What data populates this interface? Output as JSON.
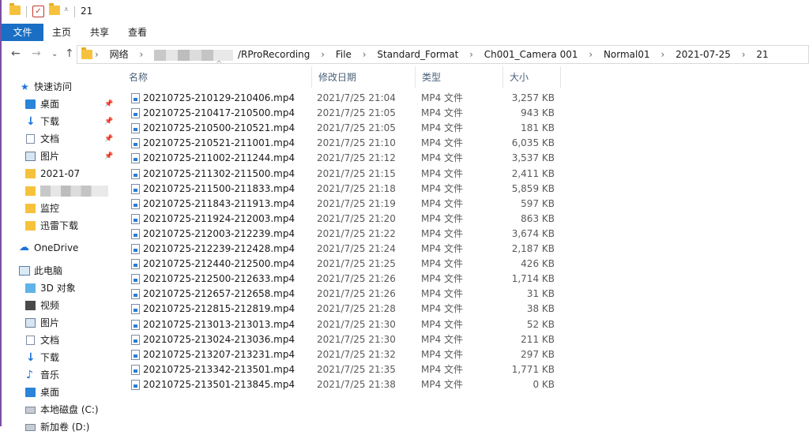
{
  "window": {
    "title": "21"
  },
  "ribbon": {
    "tabs": [
      "文件",
      "主页",
      "共享",
      "查看"
    ]
  },
  "address": {
    "crumbs": [
      "网络",
      "/RProRecording",
      "File",
      "Standard_Format",
      "Ch001_Camera 001",
      "Normal01",
      "2021-07-25",
      "21"
    ]
  },
  "nav": {
    "quick_access": "快速访问",
    "quick_items": [
      {
        "label": "桌面",
        "icon": "desktop-icon",
        "pinned": true
      },
      {
        "label": "下载",
        "icon": "download-icon",
        "pinned": true
      },
      {
        "label": "文档",
        "icon": "document-icon",
        "pinned": true
      },
      {
        "label": "图片",
        "icon": "picture-icon",
        "pinned": true
      },
      {
        "label": "2021-07",
        "icon": "folder-icon",
        "pinned": false
      },
      {
        "label": "",
        "icon": "folder-icon",
        "pinned": false
      },
      {
        "label": "监控",
        "icon": "folder-icon",
        "pinned": false
      },
      {
        "label": "迅雷下载",
        "icon": "folder-icon",
        "pinned": false
      }
    ],
    "onedrive": "OneDrive",
    "this_pc": "此电脑",
    "pc_items": [
      {
        "label": "3D 对象",
        "icon": "3d-objects-icon"
      },
      {
        "label": "视频",
        "icon": "video-icon"
      },
      {
        "label": "图片",
        "icon": "picture-icon"
      },
      {
        "label": "文档",
        "icon": "document-icon"
      },
      {
        "label": "下载",
        "icon": "download-icon"
      },
      {
        "label": "音乐",
        "icon": "music-icon"
      },
      {
        "label": "桌面",
        "icon": "desktop-icon"
      },
      {
        "label": "本地磁盘 (C:)",
        "icon": "drive-icon"
      },
      {
        "label": "新加卷 (D:)",
        "icon": "drive-icon"
      }
    ]
  },
  "columns": {
    "name": "名称",
    "date": "修改日期",
    "type": "类型",
    "size": "大小"
  },
  "files": [
    {
      "name": "20210725-210129-210406.mp4",
      "date": "2021/7/25 21:04",
      "type": "MP4 文件",
      "size": "3,257 KB"
    },
    {
      "name": "20210725-210417-210500.mp4",
      "date": "2021/7/25 21:05",
      "type": "MP4 文件",
      "size": "943 KB"
    },
    {
      "name": "20210725-210500-210521.mp4",
      "date": "2021/7/25 21:05",
      "type": "MP4 文件",
      "size": "181 KB"
    },
    {
      "name": "20210725-210521-211001.mp4",
      "date": "2021/7/25 21:10",
      "type": "MP4 文件",
      "size": "6,035 KB"
    },
    {
      "name": "20210725-211002-211244.mp4",
      "date": "2021/7/25 21:12",
      "type": "MP4 文件",
      "size": "3,537 KB"
    },
    {
      "name": "20210725-211302-211500.mp4",
      "date": "2021/7/25 21:15",
      "type": "MP4 文件",
      "size": "2,411 KB"
    },
    {
      "name": "20210725-211500-211833.mp4",
      "date": "2021/7/25 21:18",
      "type": "MP4 文件",
      "size": "5,859 KB"
    },
    {
      "name": "20210725-211843-211913.mp4",
      "date": "2021/7/25 21:19",
      "type": "MP4 文件",
      "size": "597 KB"
    },
    {
      "name": "20210725-211924-212003.mp4",
      "date": "2021/7/25 21:20",
      "type": "MP4 文件",
      "size": "863 KB"
    },
    {
      "name": "20210725-212003-212239.mp4",
      "date": "2021/7/25 21:22",
      "type": "MP4 文件",
      "size": "3,674 KB"
    },
    {
      "name": "20210725-212239-212428.mp4",
      "date": "2021/7/25 21:24",
      "type": "MP4 文件",
      "size": "2,187 KB"
    },
    {
      "name": "20210725-212440-212500.mp4",
      "date": "2021/7/25 21:25",
      "type": "MP4 文件",
      "size": "426 KB"
    },
    {
      "name": "20210725-212500-212633.mp4",
      "date": "2021/7/25 21:26",
      "type": "MP4 文件",
      "size": "1,714 KB"
    },
    {
      "name": "20210725-212657-212658.mp4",
      "date": "2021/7/25 21:26",
      "type": "MP4 文件",
      "size": "31 KB"
    },
    {
      "name": "20210725-212815-212819.mp4",
      "date": "2021/7/25 21:28",
      "type": "MP4 文件",
      "size": "38 KB"
    },
    {
      "name": "20210725-213013-213013.mp4",
      "date": "2021/7/25 21:30",
      "type": "MP4 文件",
      "size": "52 KB"
    },
    {
      "name": "20210725-213024-213036.mp4",
      "date": "2021/7/25 21:30",
      "type": "MP4 文件",
      "size": "211 KB"
    },
    {
      "name": "20210725-213207-213231.mp4",
      "date": "2021/7/25 21:32",
      "type": "MP4 文件",
      "size": "297 KB"
    },
    {
      "name": "20210725-213342-213501.mp4",
      "date": "2021/7/25 21:35",
      "type": "MP4 文件",
      "size": "1,771 KB"
    },
    {
      "name": "20210725-213501-213845.mp4",
      "date": "2021/7/25 21:38",
      "type": "MP4 文件",
      "size": "0 KB"
    }
  ]
}
